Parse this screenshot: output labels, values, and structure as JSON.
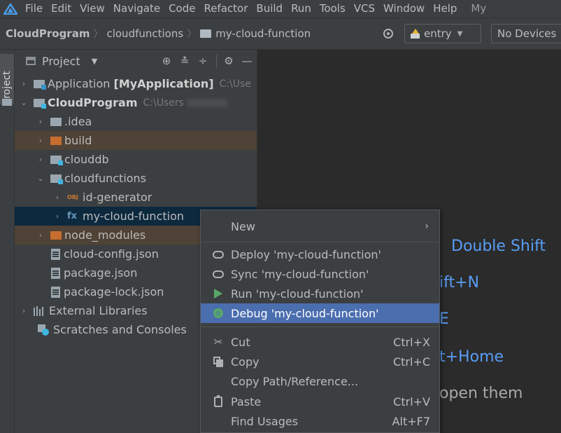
{
  "menubar": {
    "items": [
      "File",
      "Edit",
      "View",
      "Navigate",
      "Code",
      "Refactor",
      "Build",
      "Run",
      "Tools",
      "VCS",
      "Window",
      "Help",
      "My"
    ]
  },
  "breadcrumb": {
    "items": [
      "CloudProgram",
      "cloudfunctions",
      "my-cloud-function"
    ]
  },
  "run_config": {
    "entry_label": "entry",
    "device_label": "No Devices"
  },
  "side_stripe": {
    "project_tab": "Project"
  },
  "project_panel": {
    "title": "Project",
    "tree": [
      {
        "name": "Application",
        "bold_suffix": "[MyApplication]",
        "path": "C:\\Use"
      },
      {
        "name": "CloudProgram",
        "path": "C:\\Users"
      },
      {
        "name": ".idea"
      },
      {
        "name": "build"
      },
      {
        "name": "clouddb"
      },
      {
        "name": "cloudfunctions"
      },
      {
        "name": "id-generator",
        "icon_text": "OBJ"
      },
      {
        "name": "my-cloud-function",
        "icon_text": "fx"
      },
      {
        "name": "node_modules"
      },
      {
        "name": "cloud-config.json"
      },
      {
        "name": "package.json"
      },
      {
        "name": "package-lock.json"
      },
      {
        "name": "External Libraries"
      },
      {
        "name": "Scratches and Consoles"
      }
    ]
  },
  "editor_hints": {
    "line1": "Double Shift",
    "line2": "ift+N",
    "line3": "E",
    "line4": "t+Home",
    "line5": "open them"
  },
  "context_menu": {
    "items": [
      {
        "label": "New",
        "submenu_arrow": "›"
      },
      {
        "label": "Deploy 'my-cloud-function'"
      },
      {
        "label": "Sync 'my-cloud-function'"
      },
      {
        "label": "Run 'my-cloud-function'"
      },
      {
        "label": "Debug 'my-cloud-function'"
      },
      {
        "label": "Cut",
        "shortcut": "Ctrl+X"
      },
      {
        "label": "Copy",
        "shortcut": "Ctrl+C"
      },
      {
        "label": "Copy Path/Reference..."
      },
      {
        "label": "Paste",
        "shortcut": "Ctrl+V"
      },
      {
        "label": "Find Usages",
        "shortcut": "Alt+F7"
      }
    ]
  },
  "colors": {
    "accent_selection": "#4b6eaf",
    "tree_selection": "#0d293e",
    "excluded_folder": "#4f4236",
    "hint_link": "#589df6"
  }
}
